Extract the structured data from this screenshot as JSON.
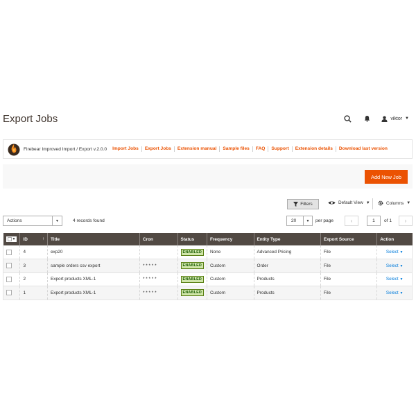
{
  "page_title": "Export Jobs",
  "header": {
    "user_name": "viktor",
    "icons": [
      "search-icon",
      "bell-icon",
      "user-icon"
    ]
  },
  "extension_bar": {
    "version_text": "Firebear Improved Import / Export v.2.0.0",
    "links": [
      "Import Jobs",
      "Export Jobs",
      "Extension manual",
      "Sample files",
      "FAQ",
      "Support",
      "Extension details",
      "Download last version"
    ]
  },
  "add_new_job_label": "Add New Job",
  "toolbar": {
    "filters_label": "Filters",
    "view_label": "Default View",
    "columns_label": "Columns",
    "actions_label": "Actions",
    "records_found": "4 records found",
    "per_page_value": "20",
    "per_page_label": "per page",
    "current_page": "1",
    "of_pages": "of 1"
  },
  "colors": {
    "accent": "#eb5202",
    "header_bg": "#514943",
    "link": "#007bdb",
    "enabled_bg": "#d0e5a9"
  },
  "table": {
    "columns": [
      "ID",
      "Title",
      "Cron",
      "Status",
      "Frequency",
      "Entity Type",
      "Export Source",
      "Action"
    ],
    "rows": [
      {
        "id": "4",
        "title": "exp20",
        "cron": "",
        "status": "ENABLED",
        "frequency": "None",
        "entity_type": "Advanced Pricing",
        "export_source": "File",
        "action": "Select"
      },
      {
        "id": "3",
        "title": "sample orders csv export",
        "cron": "* * * * *",
        "status": "ENABLED",
        "frequency": "Custom",
        "entity_type": "Order",
        "export_source": "File",
        "action": "Select"
      },
      {
        "id": "2",
        "title": "Export products XML-1",
        "cron": "* * * * *",
        "status": "ENABLED",
        "frequency": "Custom",
        "entity_type": "Products",
        "export_source": "File",
        "action": "Select"
      },
      {
        "id": "1",
        "title": "Export products XML-1",
        "cron": "* * * * *",
        "status": "ENABLED",
        "frequency": "Custom",
        "entity_type": "Products",
        "export_source": "File",
        "action": "Select"
      }
    ]
  }
}
